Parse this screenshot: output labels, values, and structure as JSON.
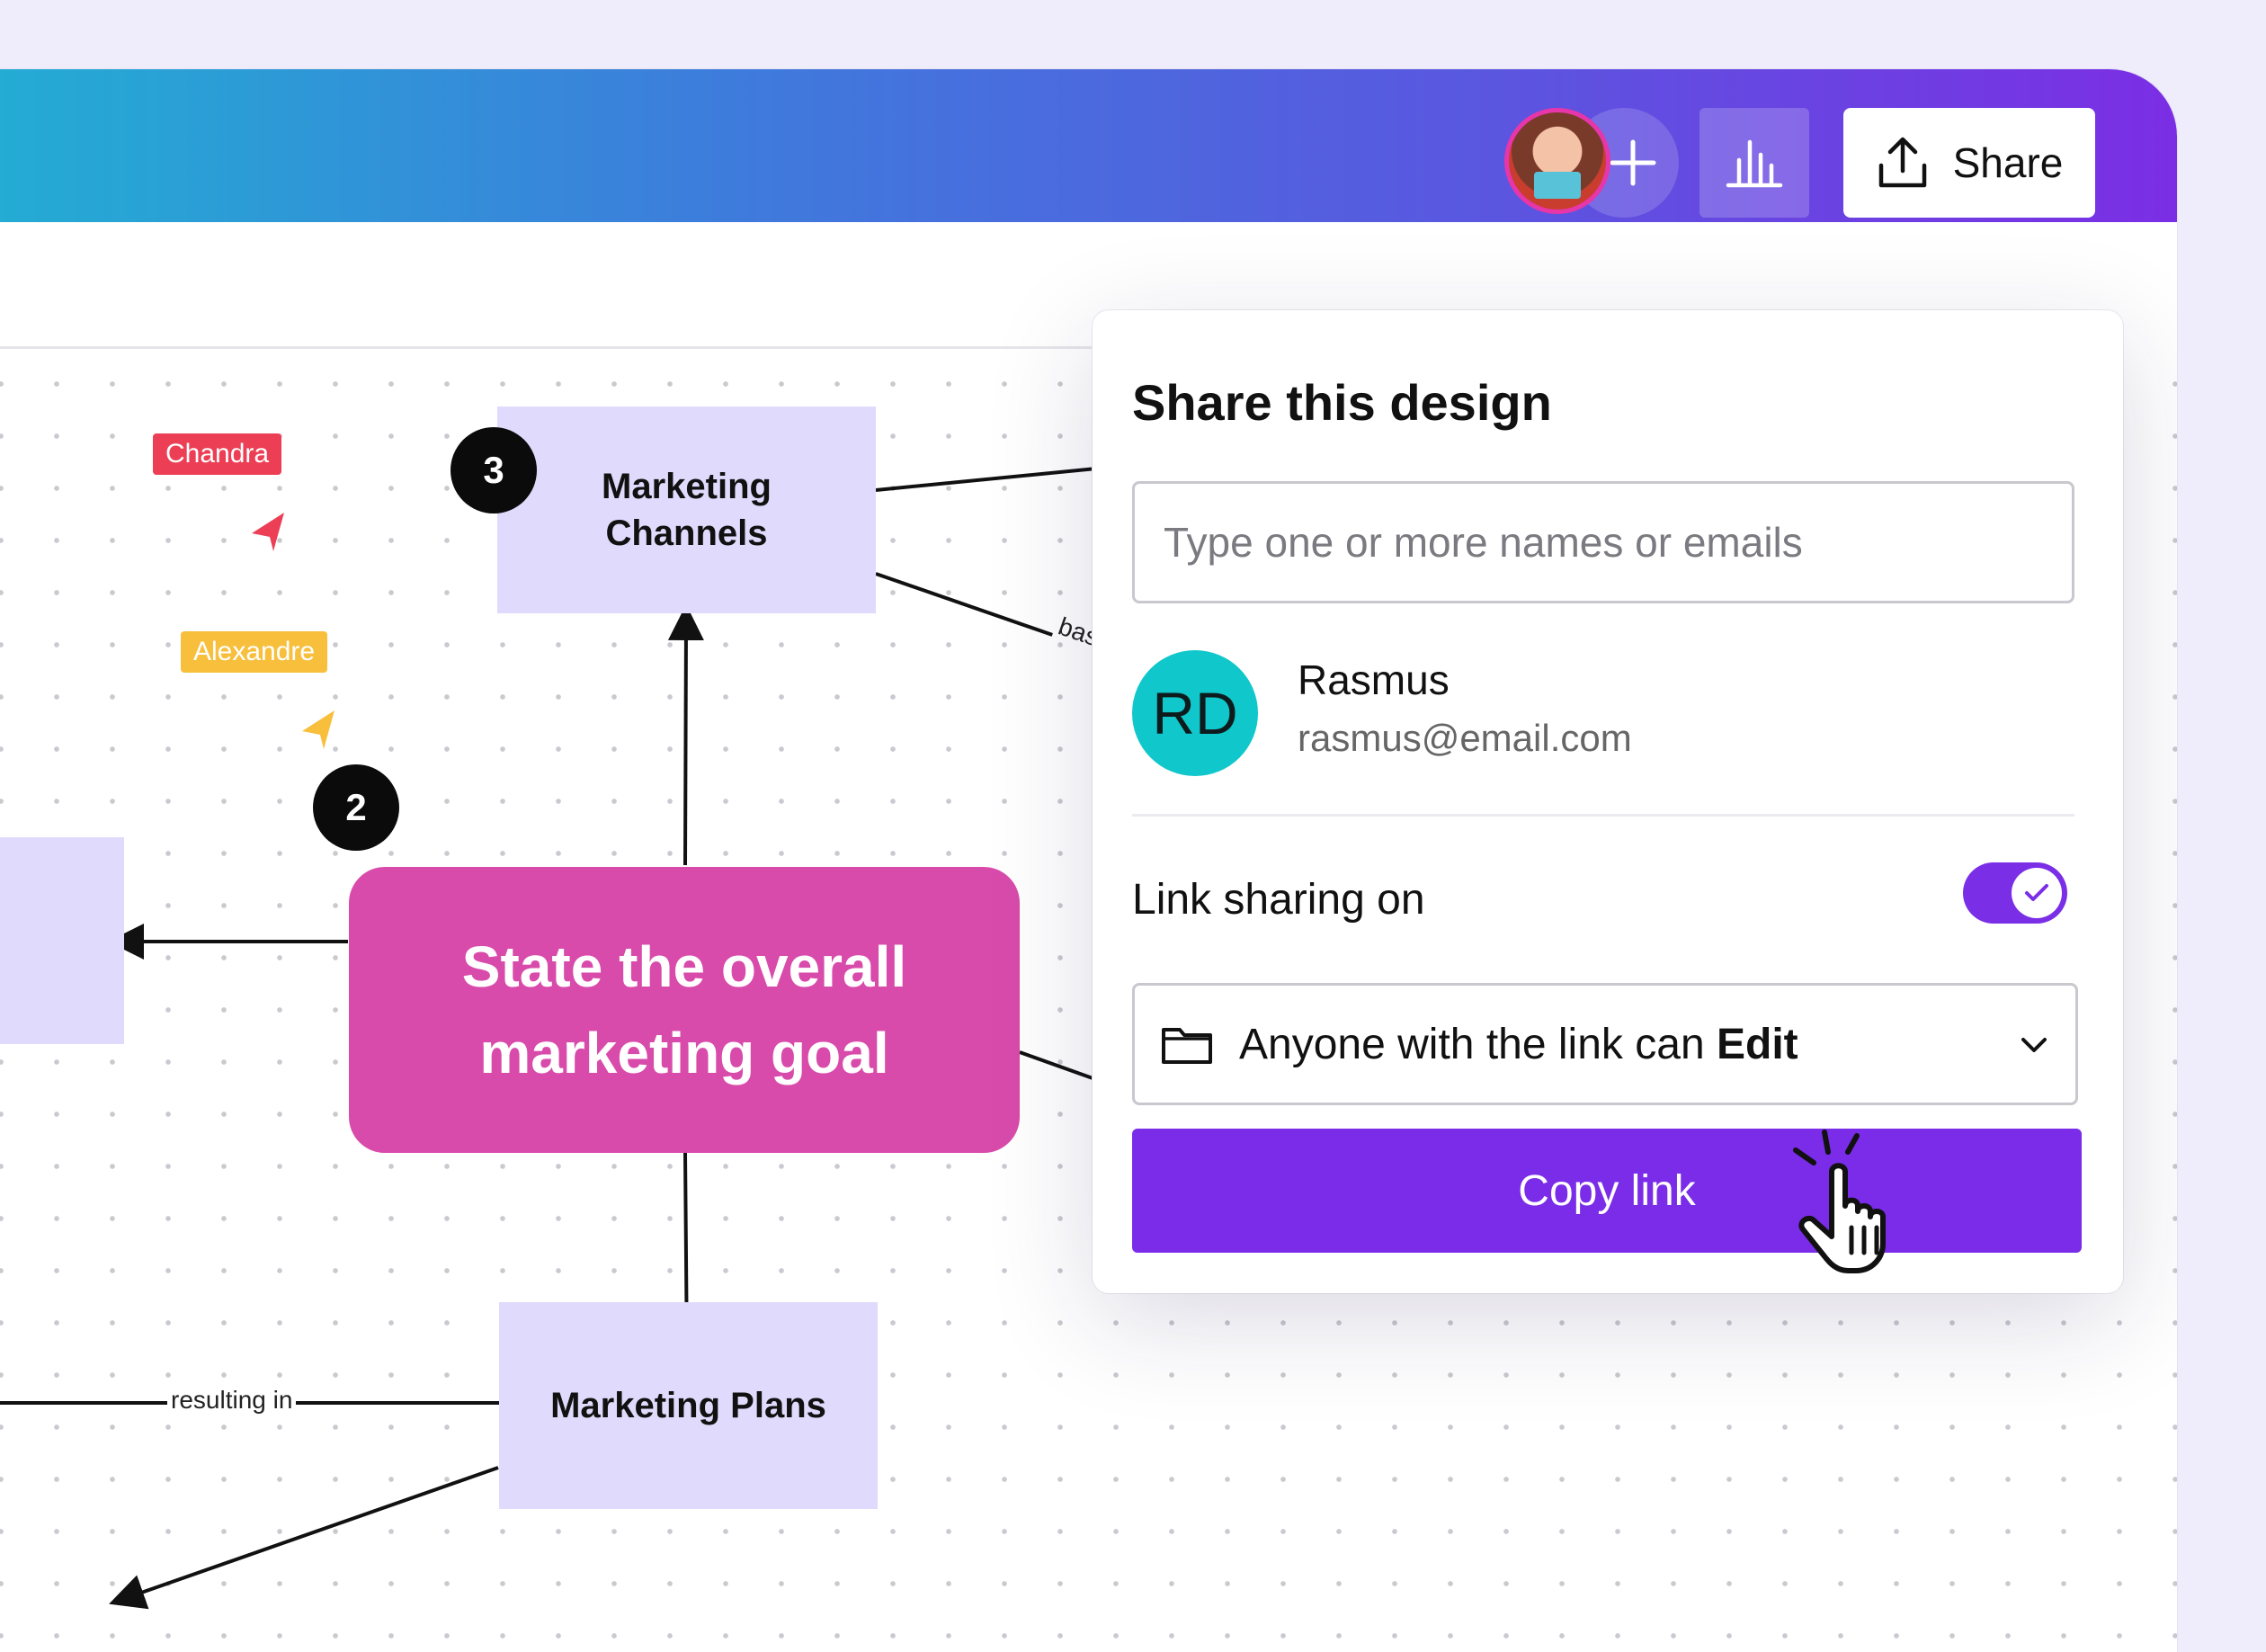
{
  "header": {
    "share_label": "Share",
    "gradient_colors": [
      "#22aed3",
      "#7b2ee4"
    ]
  },
  "icons": {
    "add_collaborator": "plus-icon",
    "insights": "bar-chart-icon",
    "share": "upload-icon",
    "folder": "folder-icon",
    "dropdown": "chevron-down-icon",
    "toggle_check": "check-icon",
    "cursor": "hand-pointer-icon"
  },
  "canvas": {
    "cursors": [
      {
        "name": "Chandra",
        "color": "#ec3f55"
      },
      {
        "name": "Alexandre",
        "color": "#f7bf3c"
      }
    ],
    "nodes": {
      "goal": "State the overall marketing goal",
      "channels": "Marketing Channels",
      "plans": "Marketing Plans"
    },
    "badges": {
      "channels": "3",
      "goal": "2"
    },
    "edge_labels": {
      "based": "based",
      "resulting": "resulting in"
    }
  },
  "share_panel": {
    "title": "Share this design",
    "input_placeholder": "Type one or more names or emails",
    "person": {
      "initials": "RD",
      "name": "Rasmus",
      "email": "rasmus@email.com"
    },
    "link_sharing_label": "Link sharing on",
    "link_sharing_on": true,
    "access_prefix": "Anyone with the link can ",
    "access_level": "Edit",
    "copy_button": "Copy link",
    "accent_color": "#7a2ce8"
  }
}
